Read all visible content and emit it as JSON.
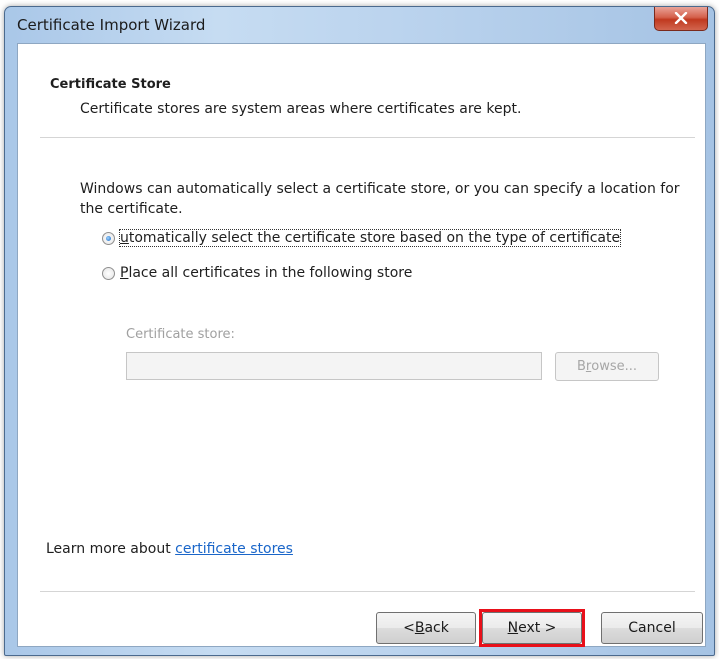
{
  "window": {
    "title": "Certificate Import Wizard",
    "close_icon": "close-icon"
  },
  "header": {
    "title": "Certificate Store",
    "subtitle": "Certificate stores are system areas where certificates are kept."
  },
  "intro": "Windows can automatically select a certificate store, or you can specify a location for the certificate.",
  "options": {
    "auto": {
      "pre": "",
      "accel": "u",
      "post": "tomatically select the certificate store based on the type of certificate",
      "selected": true
    },
    "manual": {
      "pre": "",
      "accel": "P",
      "post": "lace all certificates in the following store",
      "selected": false
    }
  },
  "store": {
    "label": "Certificate store:",
    "value": "",
    "browse_pre": "B",
    "browse_accel": "r",
    "browse_post": "owse..."
  },
  "learn_more": {
    "text": "Learn more about ",
    "link": "certificate stores"
  },
  "buttons": {
    "back_pre": "< ",
    "back_accel": "B",
    "back_post": "ack",
    "next_accel": "N",
    "next_post": "ext >",
    "cancel": "Cancel"
  },
  "colors": {
    "link": "#1a66c9",
    "highlight": "#e8101a",
    "close_button": "#c0391f"
  }
}
